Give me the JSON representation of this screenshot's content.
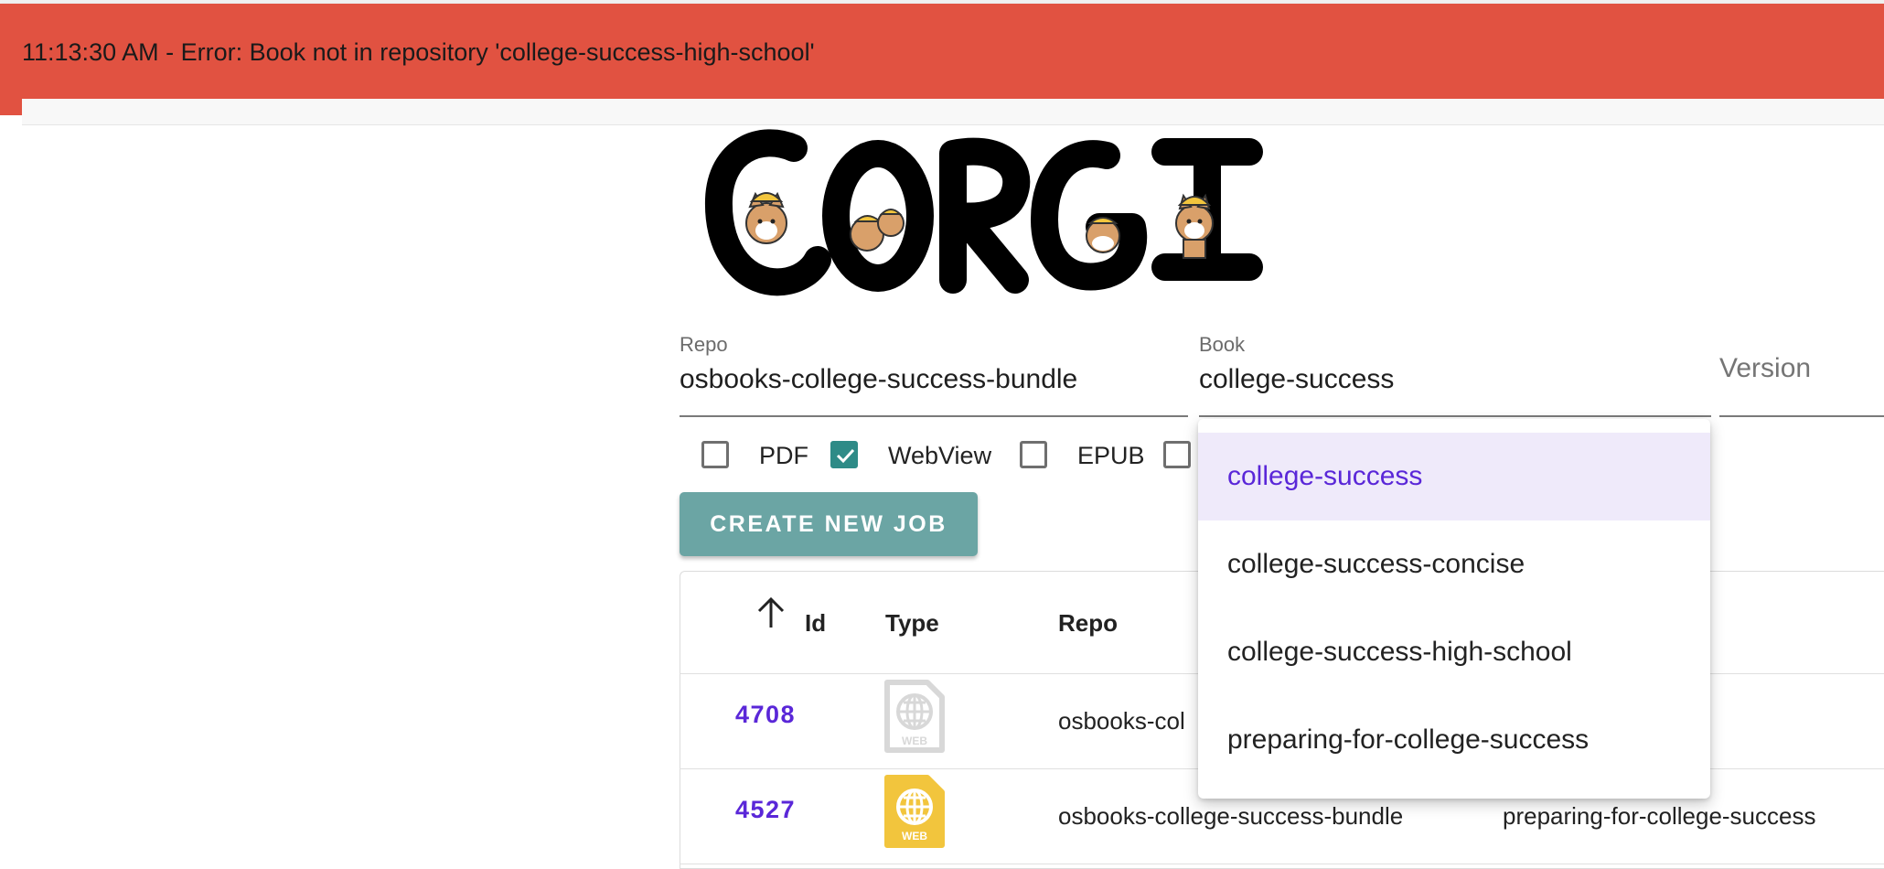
{
  "error": {
    "message": "11:13:30 AM - Error: Book not in repository 'college-success-high-school'"
  },
  "logo": {
    "text": "CORGI"
  },
  "form": {
    "repo": {
      "label": "Repo",
      "value": "osbooks-college-success-bundle"
    },
    "book": {
      "label": "Book",
      "value": "college-success"
    },
    "version": {
      "placeholder": "Version"
    },
    "formats": [
      {
        "label": "PDF",
        "checked": false
      },
      {
        "label": "WebView",
        "checked": true
      },
      {
        "label": "EPUB",
        "checked": false
      }
    ],
    "create_button": "CREATE NEW JOB"
  },
  "book_dropdown": {
    "options": [
      "college-success",
      "college-success-concise",
      "college-success-high-school",
      "preparing-for-college-success"
    ],
    "selected_index": 0
  },
  "jobs_table": {
    "columns": {
      "id": "Id",
      "type": "Type",
      "repo": "Repo"
    },
    "sort": {
      "column": "Id",
      "direction": "ascending",
      "icon": "arrow-up-icon"
    },
    "rows": [
      {
        "id": "4708",
        "type_icon": "web-file-icon-inactive",
        "repo": "osbooks-col",
        "book": ""
      },
      {
        "id": "4527",
        "type_icon": "web-file-icon-active",
        "repo": "osbooks-college-success-bundle",
        "book": "preparing-for-college-success"
      }
    ]
  },
  "colors": {
    "error_bar": "#e15241",
    "accent_teal": "#2e8b87",
    "button_teal": "#6ba5a4",
    "link_purple": "#5a27d8",
    "selected_bg": "#efeafa",
    "web_icon_active": "#f2c53d",
    "web_icon_inactive": "#d8d8d8"
  }
}
